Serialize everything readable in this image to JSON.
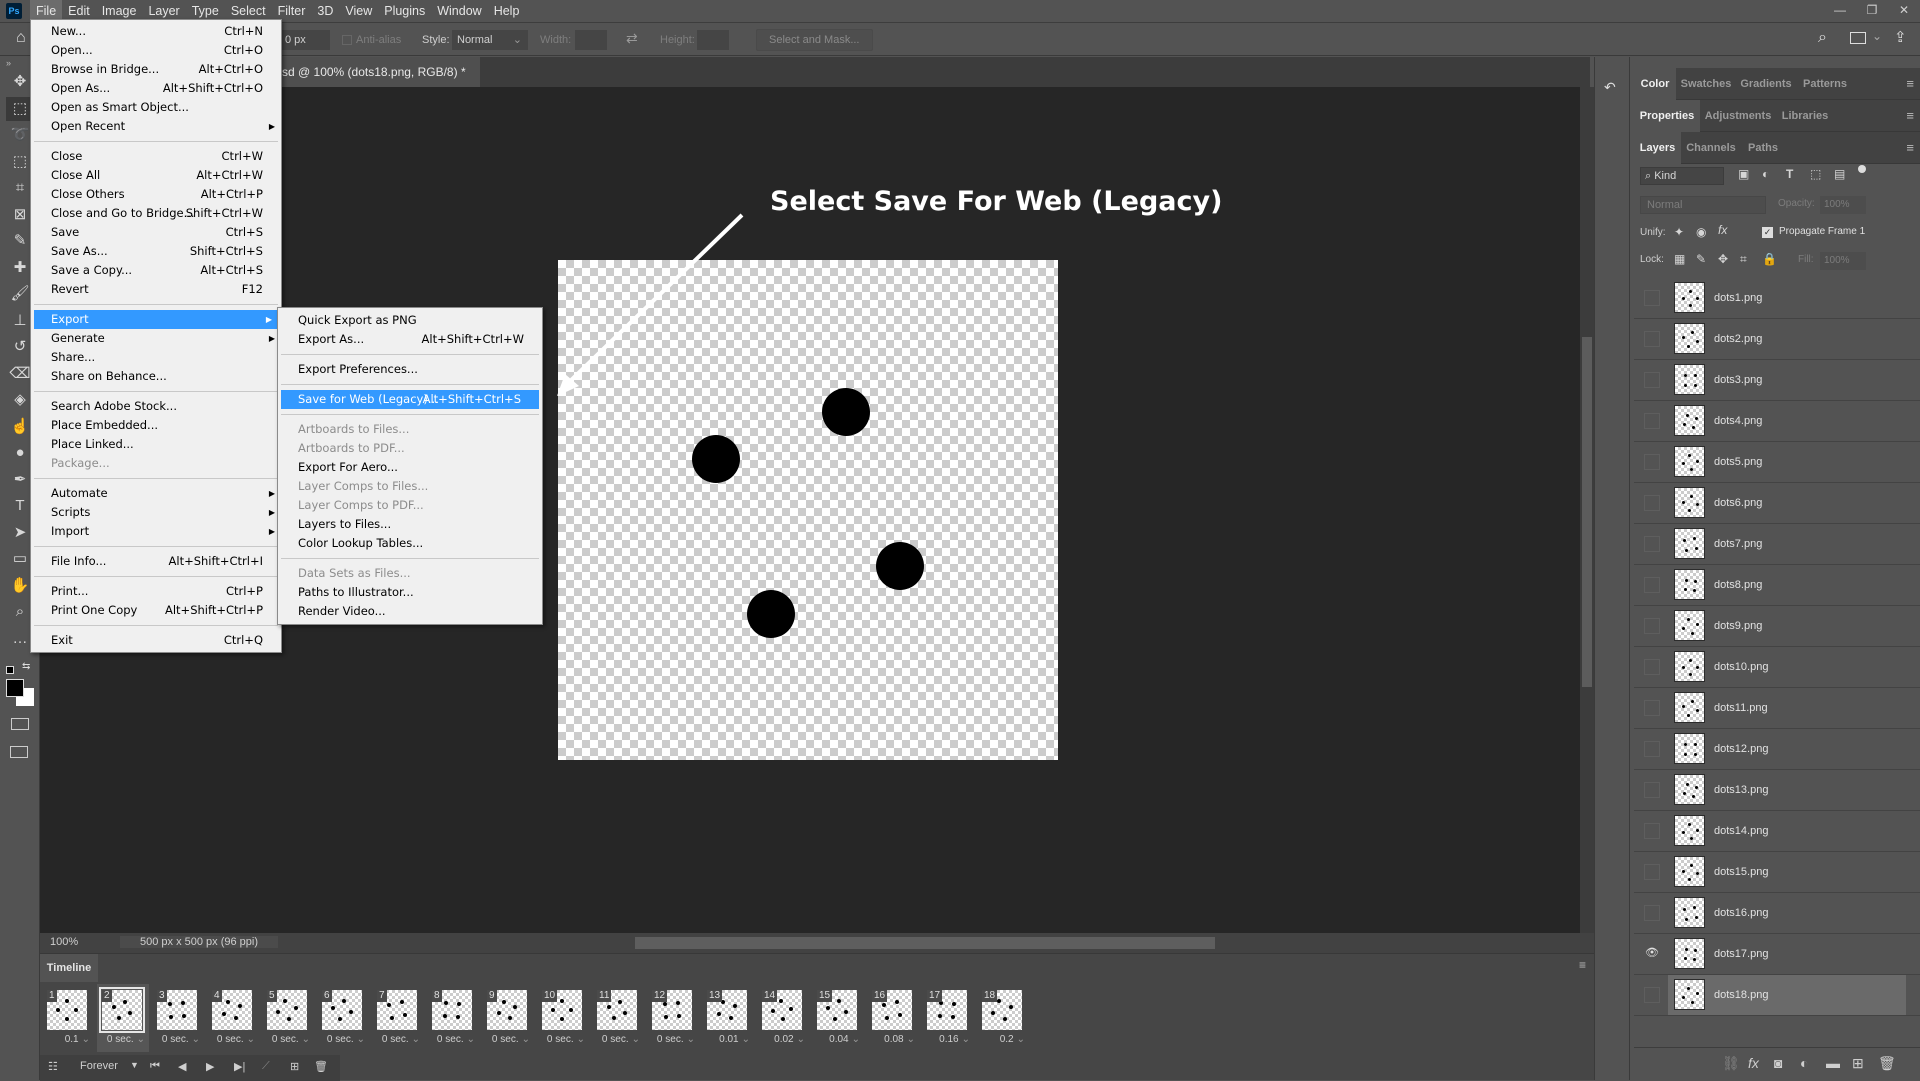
{
  "app": {
    "logo": "Ps",
    "menubar": [
      "File",
      "Edit",
      "Image",
      "Layer",
      "Type",
      "Select",
      "Filter",
      "3D",
      "View",
      "Plugins",
      "Window",
      "Help"
    ],
    "active_menu": "File",
    "window_controls": {
      "minimize": "—",
      "restore": "❐",
      "close": "✕"
    }
  },
  "options_bar": {
    "feather_value": "0 px",
    "antialias_label": "Anti-alias",
    "style_label": "Style:",
    "style_value": "Normal",
    "width_label": "Width:",
    "height_label": "Height:",
    "select_mask_label": "Select and Mask..."
  },
  "document": {
    "tab_title": "sd @ 100% (dots18.png, RGB/8) *",
    "tab_close": "×",
    "zoom": "100%",
    "dimensions": "500 px x 500 px (96 ppi)",
    "annotation": "Select Save For Web (Legacy)"
  },
  "file_menu": {
    "groups": [
      [
        {
          "label": "New...",
          "shortcut": "Ctrl+N"
        },
        {
          "label": "Open...",
          "shortcut": "Ctrl+O"
        },
        {
          "label": "Browse in Bridge...",
          "shortcut": "Alt+Ctrl+O"
        },
        {
          "label": "Open As...",
          "shortcut": "Alt+Shift+Ctrl+O"
        },
        {
          "label": "Open as Smart Object...",
          "shortcut": ""
        },
        {
          "label": "Open Recent",
          "shortcut": "",
          "submenu": true
        }
      ],
      [
        {
          "label": "Close",
          "shortcut": "Ctrl+W"
        },
        {
          "label": "Close All",
          "shortcut": "Alt+Ctrl+W"
        },
        {
          "label": "Close Others",
          "shortcut": "Alt+Ctrl+P"
        },
        {
          "label": "Close and Go to Bridge...",
          "shortcut": "Shift+Ctrl+W"
        },
        {
          "label": "Save",
          "shortcut": "Ctrl+S"
        },
        {
          "label": "Save As...",
          "shortcut": "Shift+Ctrl+S"
        },
        {
          "label": "Save a Copy...",
          "shortcut": "Alt+Ctrl+S"
        },
        {
          "label": "Revert",
          "shortcut": "F12"
        }
      ],
      [
        {
          "label": "Export",
          "shortcut": "",
          "submenu": true,
          "highlighted": true
        },
        {
          "label": "Generate",
          "shortcut": "",
          "submenu": true
        },
        {
          "label": "Share...",
          "shortcut": ""
        },
        {
          "label": "Share on Behance...",
          "shortcut": ""
        }
      ],
      [
        {
          "label": "Search Adobe Stock...",
          "shortcut": ""
        },
        {
          "label": "Place Embedded...",
          "shortcut": ""
        },
        {
          "label": "Place Linked...",
          "shortcut": ""
        },
        {
          "label": "Package...",
          "shortcut": "",
          "disabled": true
        }
      ],
      [
        {
          "label": "Automate",
          "shortcut": "",
          "submenu": true
        },
        {
          "label": "Scripts",
          "shortcut": "",
          "submenu": true
        },
        {
          "label": "Import",
          "shortcut": "",
          "submenu": true
        }
      ],
      [
        {
          "label": "File Info...",
          "shortcut": "Alt+Shift+Ctrl+I"
        }
      ],
      [
        {
          "label": "Print...",
          "shortcut": "Ctrl+P"
        },
        {
          "label": "Print One Copy",
          "shortcut": "Alt+Shift+Ctrl+P"
        }
      ],
      [
        {
          "label": "Exit",
          "shortcut": "Ctrl+Q"
        }
      ]
    ]
  },
  "export_submenu": {
    "groups": [
      [
        {
          "label": "Quick Export as PNG",
          "shortcut": ""
        },
        {
          "label": "Export As...",
          "shortcut": "Alt+Shift+Ctrl+W"
        }
      ],
      [
        {
          "label": "Export Preferences...",
          "shortcut": ""
        }
      ],
      [
        {
          "label": "Save for Web (Legacy)...",
          "shortcut": "Alt+Shift+Ctrl+S",
          "highlighted": true
        }
      ],
      [
        {
          "label": "Artboards to Files...",
          "shortcut": "",
          "disabled": true
        },
        {
          "label": "Artboards to PDF...",
          "shortcut": "",
          "disabled": true
        },
        {
          "label": "Export For Aero...",
          "shortcut": ""
        },
        {
          "label": "Layer Comps to Files...",
          "shortcut": "",
          "disabled": true
        },
        {
          "label": "Layer Comps to PDF...",
          "shortcut": "",
          "disabled": true
        },
        {
          "label": "Layers to Files...",
          "shortcut": ""
        },
        {
          "label": "Color Lookup Tables...",
          "shortcut": ""
        }
      ],
      [
        {
          "label": "Data Sets as Files...",
          "shortcut": "",
          "disabled": true
        },
        {
          "label": "Paths to Illustrator...",
          "shortcut": ""
        },
        {
          "label": "Render Video...",
          "shortcut": ""
        }
      ]
    ]
  },
  "tools": [
    "move",
    "rectangular-marquee",
    "lasso",
    "object-selection",
    "crop",
    "frame",
    "eyedropper",
    "healing-brush",
    "brush",
    "clone-stamp",
    "history-brush",
    "eraser",
    "paint-bucket",
    "smudge",
    "dodge",
    "pen",
    "type",
    "path-selection",
    "rectangle",
    "hand",
    "zoom",
    "more"
  ],
  "panels": {
    "color_tabs": [
      "Color",
      "Swatches",
      "Gradients",
      "Patterns"
    ],
    "properties_tabs": [
      "Properties",
      "Adjustments",
      "Libraries"
    ],
    "layers_tabs": [
      "Layers",
      "Channels",
      "Paths"
    ],
    "filter_kind": "Kind",
    "blend_mode": "Normal",
    "opacity_label": "Opacity:",
    "opacity_value": "100%",
    "unify_label": "Unify:",
    "propagate_label": "Propagate Frame 1",
    "propagate_checked": true,
    "lock_label": "Lock:",
    "fill_label": "Fill:",
    "fill_value": "100%"
  },
  "layers": [
    {
      "name": "dots1.png",
      "visible": false,
      "selected": false
    },
    {
      "name": "dots2.png",
      "visible": false,
      "selected": false
    },
    {
      "name": "dots3.png",
      "visible": false,
      "selected": false
    },
    {
      "name": "dots4.png",
      "visible": false,
      "selected": false
    },
    {
      "name": "dots5.png",
      "visible": false,
      "selected": false
    },
    {
      "name": "dots6.png",
      "visible": false,
      "selected": false
    },
    {
      "name": "dots7.png",
      "visible": false,
      "selected": false
    },
    {
      "name": "dots8.png",
      "visible": false,
      "selected": false
    },
    {
      "name": "dots9.png",
      "visible": false,
      "selected": false
    },
    {
      "name": "dots10.png",
      "visible": false,
      "selected": false
    },
    {
      "name": "dots11.png",
      "visible": false,
      "selected": false
    },
    {
      "name": "dots12.png",
      "visible": false,
      "selected": false
    },
    {
      "name": "dots13.png",
      "visible": false,
      "selected": false
    },
    {
      "name": "dots14.png",
      "visible": false,
      "selected": false
    },
    {
      "name": "dots15.png",
      "visible": false,
      "selected": false
    },
    {
      "name": "dots16.png",
      "visible": false,
      "selected": false
    },
    {
      "name": "dots17.png",
      "visible": true,
      "selected": false
    },
    {
      "name": "dots18.png",
      "visible": false,
      "selected": true
    }
  ],
  "timeline": {
    "title": "Timeline",
    "selected_frame": 2,
    "frames": [
      {
        "num": "1",
        "delay": "0.1"
      },
      {
        "num": "2",
        "delay": "0 sec."
      },
      {
        "num": "3",
        "delay": "0 sec."
      },
      {
        "num": "4",
        "delay": "0 sec."
      },
      {
        "num": "5",
        "delay": "0 sec."
      },
      {
        "num": "6",
        "delay": "0 sec."
      },
      {
        "num": "7",
        "delay": "0 sec."
      },
      {
        "num": "8",
        "delay": "0 sec."
      },
      {
        "num": "9",
        "delay": "0 sec."
      },
      {
        "num": "10",
        "delay": "0 sec."
      },
      {
        "num": "11",
        "delay": "0 sec."
      },
      {
        "num": "12",
        "delay": "0 sec."
      },
      {
        "num": "13",
        "delay": "0.01"
      },
      {
        "num": "14",
        "delay": "0.02"
      },
      {
        "num": "15",
        "delay": "0.04"
      },
      {
        "num": "16",
        "delay": "0.08"
      },
      {
        "num": "17",
        "delay": "0.16"
      },
      {
        "num": "18",
        "delay": "0.2"
      }
    ],
    "loop": "Forever"
  }
}
